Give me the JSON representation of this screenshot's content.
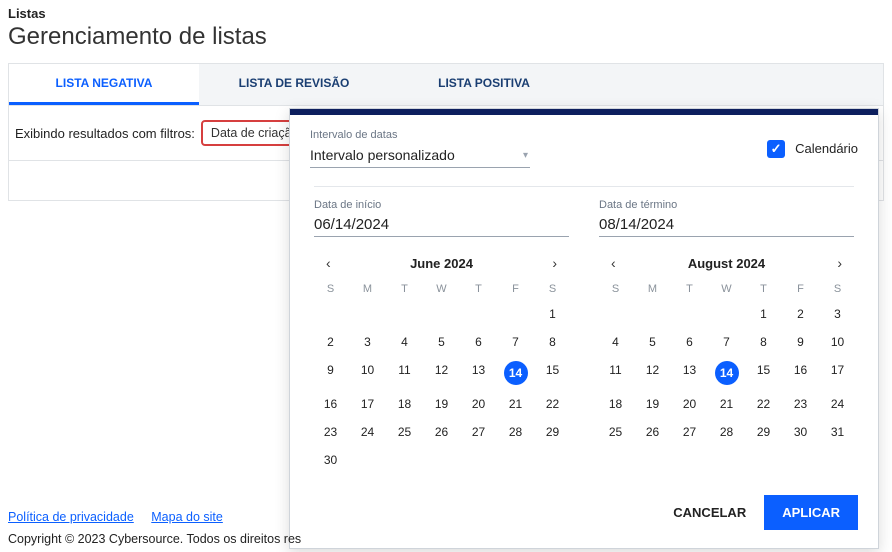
{
  "breadcrumb": "Listas",
  "title": "Gerenciamento de listas",
  "tabs": {
    "negative": "LISTA NEGATIVA",
    "review": "LISTA DE REVISÃO",
    "positive": "LISTA POSITIVA"
  },
  "filter": {
    "showing": "Exibindo resultados com filtros:",
    "chip": "Data de criação:"
  },
  "popover": {
    "interval_label": "Intervalo de datas",
    "interval_value": "Intervalo personalizado",
    "calendar_label": "Calendário",
    "start": {
      "label": "Data de início",
      "value": "06/14/2024",
      "month_title": "June 2024",
      "dow": [
        "S",
        "M",
        "T",
        "W",
        "T",
        "F",
        "S"
      ],
      "leading_blanks": 6,
      "days_in_month": 30,
      "selected": 14
    },
    "end": {
      "label": "Data de término",
      "value": "08/14/2024",
      "month_title": "August 2024",
      "dow": [
        "S",
        "M",
        "T",
        "W",
        "T",
        "F",
        "S"
      ],
      "leading_blanks": 4,
      "days_in_month": 31,
      "selected": 14
    },
    "cancel": "CANCELAR",
    "apply": "APLICAR"
  },
  "footer": {
    "privacy": "Política de privacidade",
    "sitemap": "Mapa do site",
    "copyright": "Copyright © 2023 Cybersource. Todos os direitos res"
  }
}
